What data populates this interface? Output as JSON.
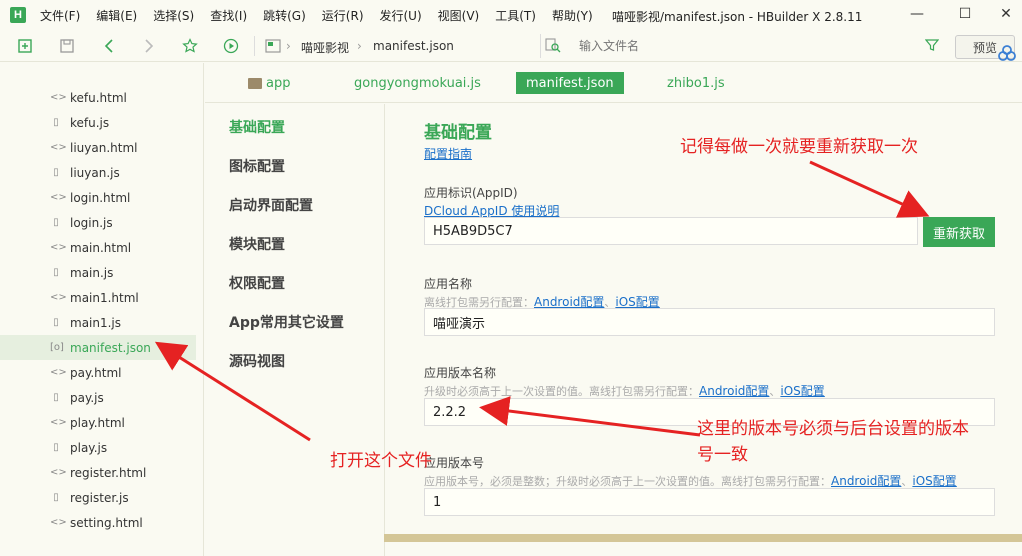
{
  "menu": {
    "logo": "H",
    "items": [
      "文件(F)",
      "编辑(E)",
      "选择(S)",
      "查找(I)",
      "跳转(G)",
      "运行(R)",
      "发行(U)",
      "视图(V)",
      "工具(T)",
      "帮助(Y)"
    ],
    "window_title": "喵哑影视/manifest.json - HBuilder X 2.8.11"
  },
  "toolbar": {
    "breadcrumb": [
      "喵哑影视",
      "manifest.json"
    ],
    "file_search_placeholder": "输入文件名",
    "preview_label": "预览"
  },
  "files": [
    {
      "name": "kefu.html",
      "icon": "<>"
    },
    {
      "name": "kefu.js",
      "icon": "▯"
    },
    {
      "name": "liuyan.html",
      "icon": "<>"
    },
    {
      "name": "liuyan.js",
      "icon": "▯"
    },
    {
      "name": "login.html",
      "icon": "<>"
    },
    {
      "name": "login.js",
      "icon": "▯"
    },
    {
      "name": "main.html",
      "icon": "<>"
    },
    {
      "name": "main.js",
      "icon": "▯"
    },
    {
      "name": "main1.html",
      "icon": "<>"
    },
    {
      "name": "main1.js",
      "icon": "▯"
    },
    {
      "name": "manifest.json",
      "icon": "[o]",
      "active": true
    },
    {
      "name": "pay.html",
      "icon": "<>"
    },
    {
      "name": "pay.js",
      "icon": "▯"
    },
    {
      "name": "play.html",
      "icon": "<>"
    },
    {
      "name": "play.js",
      "icon": "▯"
    },
    {
      "name": "register.html",
      "icon": "<>"
    },
    {
      "name": "register.js",
      "icon": "▯"
    },
    {
      "name": "setting.html",
      "icon": "<>"
    }
  ],
  "tabs": [
    "app",
    "gongyongmokuai.js",
    "manifest.json",
    "zhibo1.js"
  ],
  "settings_nav": [
    "基础配置",
    "图标配置",
    "启动界面配置",
    "模块配置",
    "权限配置",
    "App常用其它设置",
    "源码视图"
  ],
  "content": {
    "title": "基础配置",
    "guide_link": "配置指南",
    "appid": {
      "label": "应用标识(AppID)",
      "help_link": "DCloud AppID 使用说明",
      "value": "H5AB9D5C7",
      "button": "重新获取"
    },
    "appname": {
      "label": "应用名称",
      "hint": "离线打包需另行配置：",
      "android_link": "Android配置",
      "ios_link": "iOS配置",
      "value": "喵哑演示"
    },
    "version_name": {
      "label": "应用版本名称",
      "hint": "升级时必须高于上一次设置的值。离线打包需另行配置：",
      "android_link": "Android配置",
      "ios_link": "iOS配置",
      "value": "2.2.2"
    },
    "version_code": {
      "label": "应用版本号",
      "hint": "应用版本号，必须是整数；升级时必须高于上一次设置的值。离线打包需另行配置：",
      "android_link": "Android配置",
      "ios_link": "iOS配置",
      "value": "1"
    }
  },
  "annotations": {
    "refetch_note": "记得每做一次就要重新获取一次",
    "open_file_note": "打开这个文件",
    "version_note_line1": "这里的版本号必须与后台设置的版本",
    "version_note_line2": "号一致"
  },
  "colors": {
    "accent": "#3aa757",
    "annotation": "#e52222",
    "link": "#1a6fc9"
  }
}
